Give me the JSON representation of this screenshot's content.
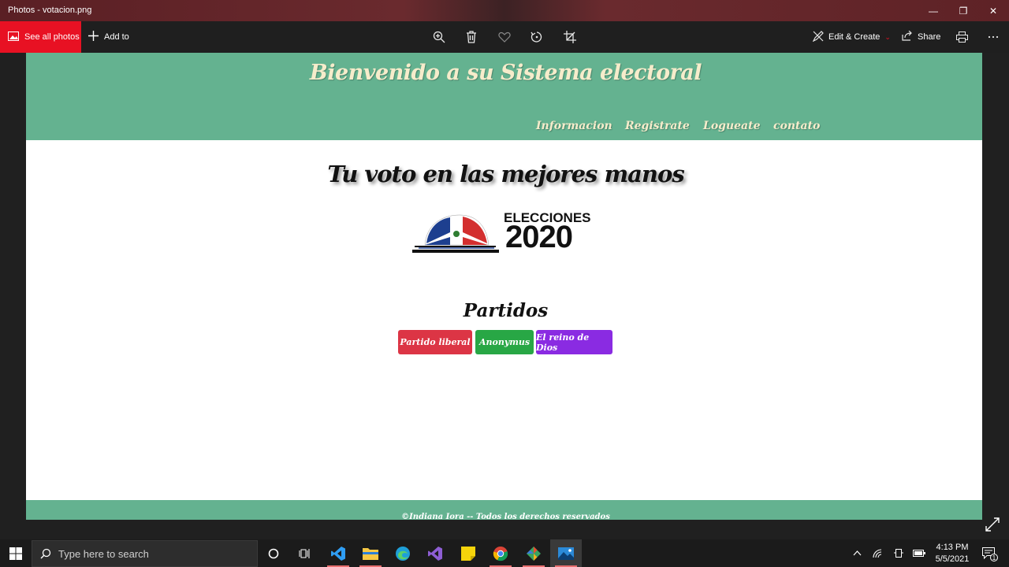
{
  "window": {
    "title": "Photos - votacion.png",
    "minimize_glyph": "—",
    "maximize_glyph": "❐",
    "close_glyph": "✕"
  },
  "toolbar": {
    "see_all_photos": "See all photos",
    "add_to": "Add to",
    "edit_create": "Edit & Create",
    "share": "Share",
    "icons": [
      "zoom-icon",
      "delete-icon",
      "favorite-icon",
      "rotate-icon",
      "crop-icon",
      "print-icon",
      "more-icon"
    ]
  },
  "site": {
    "header_title": "Bienvenido a su Sistema electoral",
    "nav": [
      "Informacion",
      "Registrate",
      "Logueate",
      "contato"
    ],
    "tagline": "Tu voto en las mejores manos",
    "logo": {
      "line1": "ELECCIONES",
      "line2": "2020"
    },
    "partidos_heading": "Partidos",
    "parties": [
      {
        "label": "Partido liberal",
        "color": "#dc3545"
      },
      {
        "label": "Anonymus",
        "color": "#28a745"
      },
      {
        "label": "El reino de Dios",
        "color": "#8a2be2"
      }
    ],
    "footer": "©Indiana Iora -- Todos los derechos reservados",
    "colors": {
      "header_bg": "#64b290",
      "header_text": "#f6eccb"
    }
  },
  "taskbar": {
    "search_placeholder": "Type here to search",
    "time": "4:13 PM",
    "date": "5/5/2021",
    "notification_count": "1",
    "apps": [
      "cortana",
      "task-view",
      "vscode",
      "file-explorer",
      "edge",
      "visual-studio",
      "sticky-notes",
      "chrome",
      "git",
      "photos"
    ]
  }
}
